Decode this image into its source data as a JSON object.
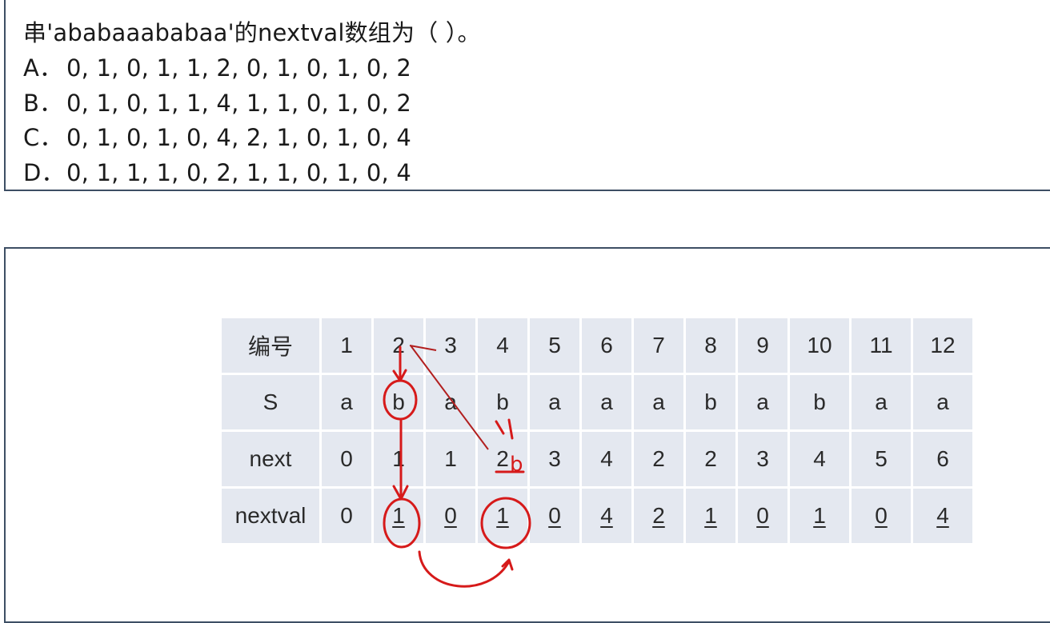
{
  "question": {
    "text": "串'ababaaababaa'的nextval数组为（ ）。",
    "options": [
      {
        "letter": "A．",
        "values": "0, 1, 0, 1, 1, 2, 0, 1, 0, 1, 0, 2"
      },
      {
        "letter": "B．",
        "values": "0, 1, 0, 1, 1, 4, 1, 1, 0, 1, 0, 2"
      },
      {
        "letter": "C．",
        "values": "0, 1, 0, 1, 0, 4, 2, 1, 0, 1, 0, 4"
      },
      {
        "letter": "D．",
        "values": "0, 1, 1, 1, 0, 2, 1, 1, 0, 1, 0, 4"
      }
    ]
  },
  "table": {
    "rows": [
      {
        "label": "编号",
        "cells": [
          "1",
          "2",
          "3",
          "4",
          "5",
          "6",
          "7",
          "8",
          "9",
          "10",
          "11",
          "12"
        ]
      },
      {
        "label": "S",
        "cells": [
          "a",
          "b",
          "a",
          "b",
          "a",
          "a",
          "a",
          "b",
          "a",
          "b",
          "a",
          "a"
        ]
      },
      {
        "label": "next",
        "cells": [
          "0",
          "1",
          "1",
          "2",
          "3",
          "4",
          "2",
          "2",
          "3",
          "4",
          "5",
          "6"
        ]
      },
      {
        "label": "nextval",
        "cells": [
          "0",
          "1",
          "0",
          "1",
          "0",
          "4",
          "2",
          "1",
          "0",
          "1",
          "0",
          "4"
        ]
      }
    ]
  },
  "annotations": {
    "ink_color": "#d61a1a",
    "handwritten": [
      "b"
    ]
  }
}
